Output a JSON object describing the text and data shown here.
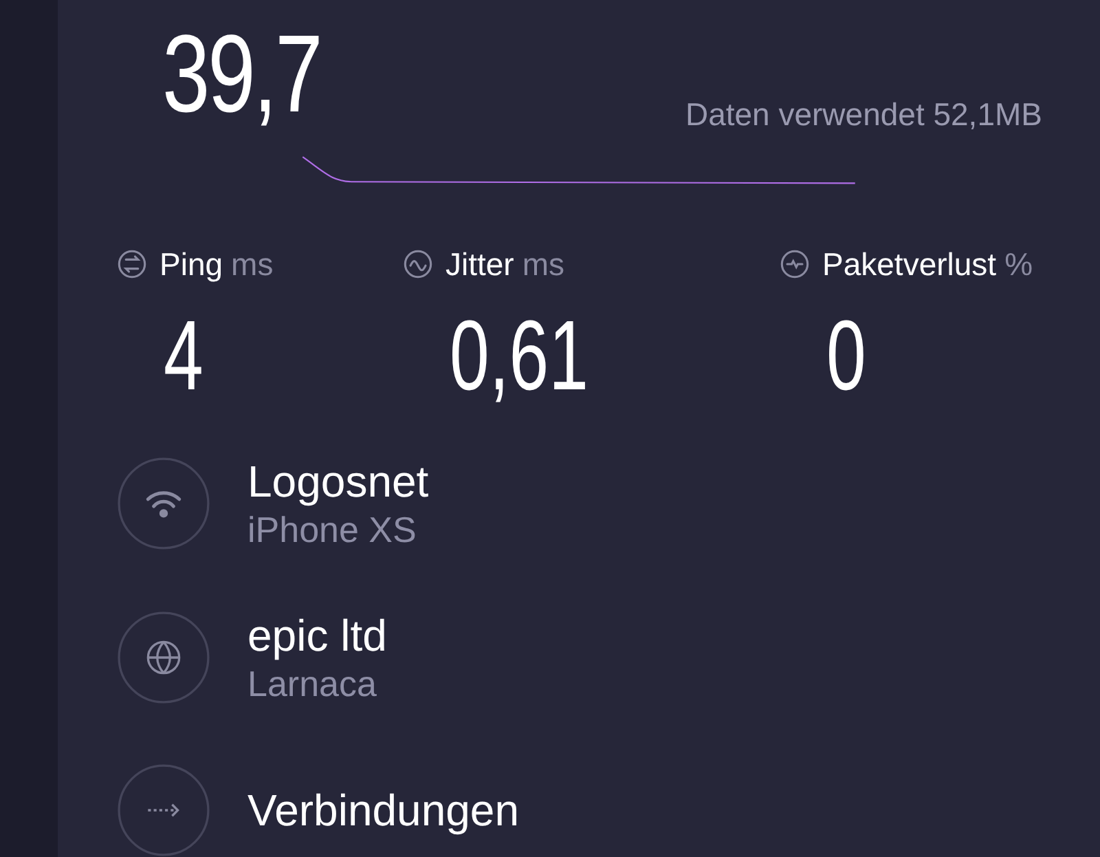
{
  "speed": {
    "value": "39,7",
    "data_used": "Daten verwendet 52,1MB"
  },
  "metrics": [
    {
      "kind": "ping",
      "label": "Ping",
      "unit": "ms",
      "value": "4"
    },
    {
      "kind": "jitter",
      "label": "Jitter",
      "unit": "ms",
      "value": "0,61"
    },
    {
      "kind": "loss",
      "label": "Paketverlust",
      "unit": "%",
      "value": "0"
    }
  ],
  "details": [
    {
      "kind": "wifi",
      "title": "Logosnet",
      "subtitle": "iPhone XS"
    },
    {
      "kind": "globe",
      "title": "epic ltd",
      "subtitle": "Larnaca"
    },
    {
      "kind": "connections",
      "title": "Verbindungen"
    }
  ]
}
